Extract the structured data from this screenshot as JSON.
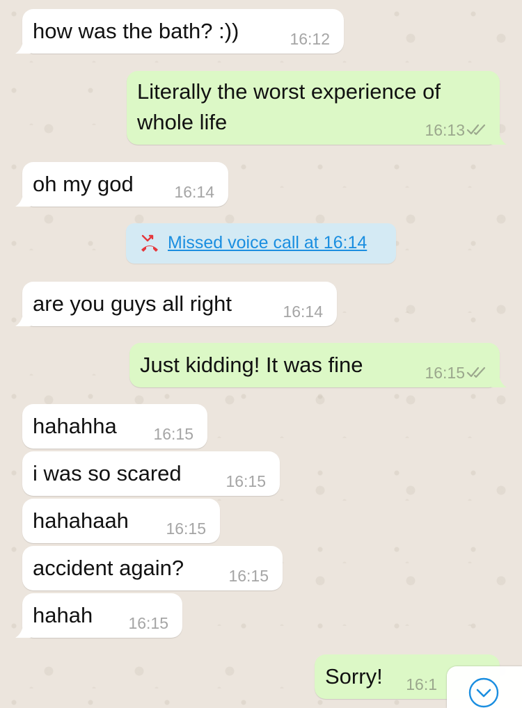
{
  "messages": [
    {
      "dir": "in",
      "text": "how was the bath? :))",
      "time": "16:12"
    },
    {
      "dir": "out",
      "text_lines": [
        "Literally the worst experience of",
        "whole life"
      ],
      "time": "16:13"
    },
    {
      "dir": "in",
      "text": "oh my god",
      "time": "16:14"
    },
    {
      "dir": "in",
      "text": "are you guys all right",
      "time": "16:14"
    },
    {
      "dir": "out",
      "text": "Just kidding! It was fine",
      "time": "16:15"
    },
    {
      "dir": "in",
      "text": "hahahha",
      "time": "16:15"
    },
    {
      "dir": "in",
      "text": "i was so scared",
      "time": "16:15"
    },
    {
      "dir": "in",
      "text": "hahahaah",
      "time": "16:15"
    },
    {
      "dir": "in",
      "text": "accident again?",
      "time": "16:15"
    },
    {
      "dir": "in",
      "text": "hahah",
      "time": "16:15"
    },
    {
      "dir": "out",
      "text": "Sorry!",
      "time": "16:1"
    }
  ],
  "missed_call": {
    "label": "Missed voice call at 16:14",
    "icon": "missed-call-icon"
  },
  "scroll_button": {
    "icon": "chevron-down-circle-icon"
  },
  "colors": {
    "incoming": "#ffffff",
    "outgoing": "#dcf8c6",
    "wallpaper": "#ece5dd",
    "missed_call_bg": "#d4eaf4",
    "link_blue": "#1a8ee0",
    "missed_red": "#e5373b",
    "read_ticks": "#9ba78d"
  }
}
